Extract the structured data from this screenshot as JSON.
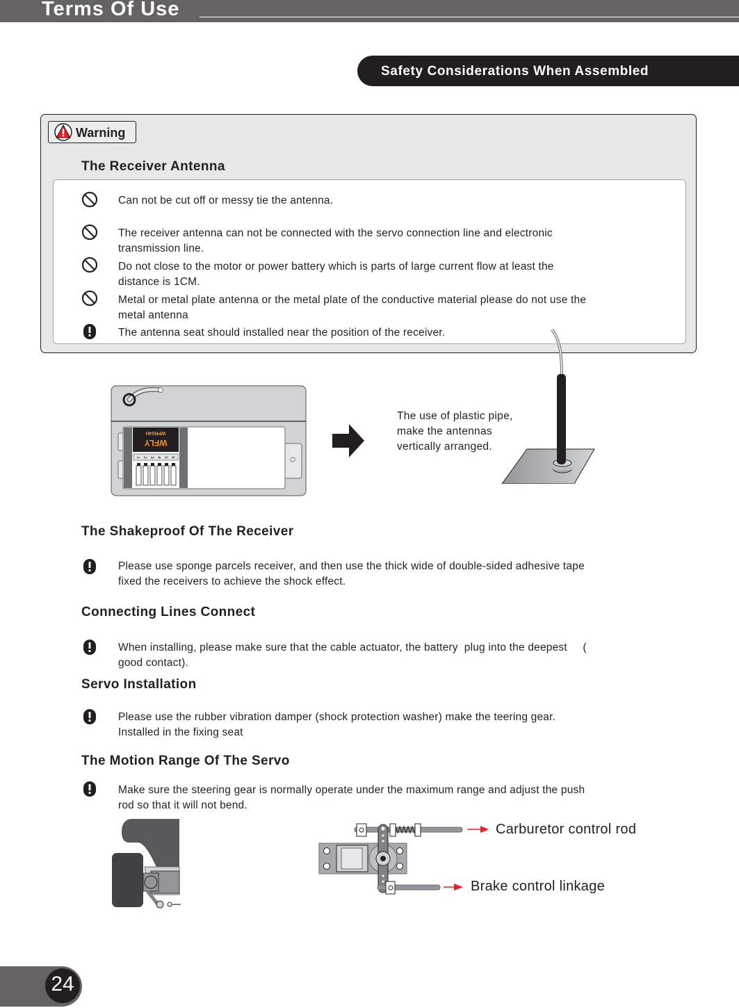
{
  "header": {
    "title": "Terms Of Use",
    "section_title": "Safety Considerations When Assembled"
  },
  "warning": {
    "badge_label": "Warning",
    "icon": "warning-triangle-icon",
    "heading": "The Receiver Antenna",
    "items": [
      {
        "icon": "prohibited-icon",
        "lines": [
          "Can not be cut off or messy tie the antenna."
        ]
      },
      {
        "icon": "prohibited-icon",
        "lines": [
          "The receiver antenna can not be connected with the servo connection line and electronic",
          "transmission line."
        ]
      },
      {
        "icon": "prohibited-icon",
        "lines": [
          "Do not close to the motor or power battery which is parts of large current flow at least the",
          "distance is  1CM."
        ]
      },
      {
        "icon": "prohibited-icon",
        "lines": [
          "Metal or metal plate antenna or the metal plate of the conductive material   please do not use the",
          "metal antenna"
        ]
      },
      {
        "icon": "exclamation-icon",
        "lines": [
          "The antenna seat should installed near the position of the receiver."
        ]
      }
    ]
  },
  "illustration_antenna": {
    "receiver_brand": "WFLY",
    "receiver_model": "WFR04H",
    "channel_labels": [
      "1",
      "2",
      "3",
      "4",
      "5",
      "6"
    ],
    "caption_lines": [
      "The use of plastic pipe,",
      "make the antennas",
      "vertically arranged."
    ]
  },
  "sections": [
    {
      "heading": "The Shakeproof Of The Receiver",
      "icon": "exclamation-icon",
      "lines": [
        "Please use sponge parcels receiver, and then use the thick wide of double-sided adhesive tape",
        "fixed the receivers to achieve the shock effect."
      ]
    },
    {
      "heading": "Connecting Lines Connect",
      "icon": "exclamation-icon",
      "lines": [
        "When installing, please make sure that the cable actuator, the battery  plug into the deepest     (",
        "good contact)."
      ]
    },
    {
      "heading": "Servo Installation",
      "icon": "exclamation-icon",
      "lines": [
        "Please use the rubber vibration damper (shock protection washer) make the teering gear.",
        "Installed in the fixing seat"
      ]
    },
    {
      "heading": "The Motion Range Of The Servo",
      "icon": "exclamation-icon",
      "lines": [
        "Make sure the steering gear is normally operate under the maximum range and adjust the push",
        "rod so that it will not bend."
      ]
    }
  ],
  "servo_diagram": {
    "label_top": "Carburetor control rod",
    "label_bottom": "Brake control linkage",
    "arrow_color": "#ed1c24"
  },
  "footer": {
    "page_number": "24"
  },
  "colors": {
    "header_gray": "#656263",
    "dark": "#231f20",
    "panel_bg": "#e7e7e8",
    "warning_red": "#ed1c24"
  }
}
